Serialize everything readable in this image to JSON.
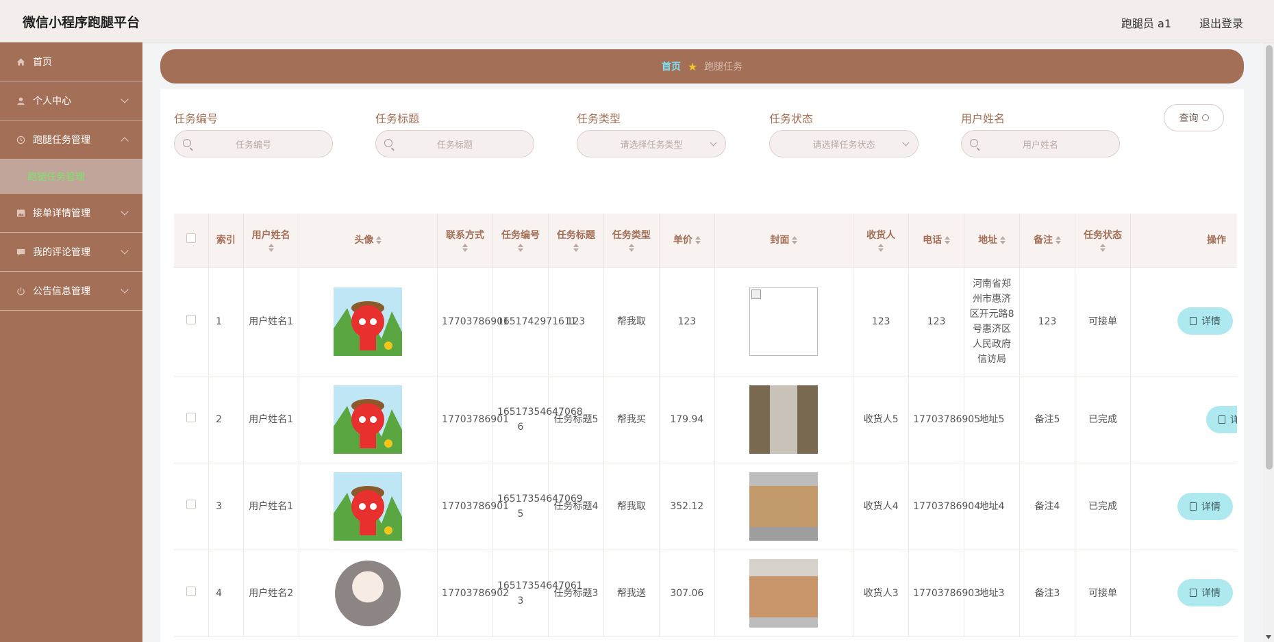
{
  "header": {
    "title": "微信小程序跑腿平台",
    "user": "跑腿员 a1",
    "logout": "退出登录"
  },
  "sidebar": {
    "items": [
      {
        "label": "首页",
        "icon": "home-icon"
      },
      {
        "label": "个人中心",
        "icon": "user-icon"
      },
      {
        "label": "跑腿任务管理",
        "icon": "clock-icon"
      },
      {
        "label": "跑腿任务管理",
        "sub": true
      },
      {
        "label": "接单详情管理",
        "icon": "image-icon"
      },
      {
        "label": "我的评论管理",
        "icon": "comment-icon"
      },
      {
        "label": "公告信息管理",
        "icon": "power-icon"
      }
    ]
  },
  "breadcrumb": {
    "home": "首页",
    "current": "跑腿任务"
  },
  "filters": {
    "task_no": {
      "label": "任务编号",
      "placeholder": "任务编号"
    },
    "task_title": {
      "label": "任务标题",
      "placeholder": "任务标题"
    },
    "task_type": {
      "label": "任务类型",
      "placeholder": "请选择任务类型"
    },
    "task_status": {
      "label": "任务状态",
      "placeholder": "请选择任务状态"
    },
    "username": {
      "label": "用户姓名",
      "placeholder": "用户姓名"
    },
    "query": "查询"
  },
  "table": {
    "headers": {
      "index": "索引",
      "username": "用户姓名",
      "avatar": "头像",
      "phone": "联系方式",
      "task_no": "任务编号",
      "task_title": "任务标题",
      "task_type": "任务类型",
      "price": "单价",
      "cover": "封面",
      "receiver": "收货人",
      "tel": "电话",
      "address": "地址",
      "remark": "备注",
      "status": "任务状态",
      "actions": "操作"
    },
    "detail_label": "详情",
    "rows": [
      {
        "index": "1",
        "username": "用户姓名1",
        "phone": "17703786901",
        "task_no": "1651742971611",
        "task_title": "123",
        "task_type": "帮我取",
        "price": "123",
        "receiver": "123",
        "tel": "123",
        "address": "河南省郑州市惠济区开元路8号惠济区人民政府信访局",
        "remark": "123",
        "status": "可接单"
      },
      {
        "index": "2",
        "username": "用户姓名1",
        "phone": "17703786901",
        "task_no": "16517354647068 6",
        "task_title": "任务标题5",
        "task_type": "帮我买",
        "price": "179.94",
        "receiver": "收货人5",
        "tel": "17703786905",
        "address": "地址5",
        "remark": "备注5",
        "status": "已完成"
      },
      {
        "index": "3",
        "username": "用户姓名1",
        "phone": "17703786901",
        "task_no": "16517354647069 5",
        "task_title": "任务标题4",
        "task_type": "帮我取",
        "price": "352.12",
        "receiver": "收货人4",
        "tel": "17703786904",
        "address": "地址4",
        "remark": "备注4",
        "status": "已完成"
      },
      {
        "index": "4",
        "username": "用户姓名2",
        "phone": "17703786902",
        "task_no": "16517354647061 3",
        "task_title": "任务标题3",
        "task_type": "帮我送",
        "price": "307.06",
        "receiver": "收货人3",
        "tel": "17703786903",
        "address": "地址3",
        "remark": "备注3",
        "status": "可接单"
      }
    ]
  },
  "colors": {
    "brand": "#a36f56",
    "accent_link": "#7ee0f5",
    "detail_button": "#aee9ef",
    "submenu_active": "#7fe36b"
  }
}
